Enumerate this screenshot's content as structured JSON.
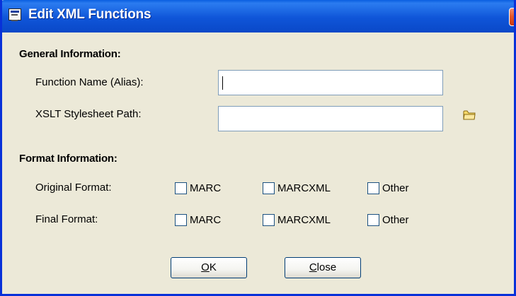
{
  "window": {
    "title": "Edit XML Functions",
    "close_symbol": "✕"
  },
  "general": {
    "heading": "General Information:",
    "function_name_label": "Function Name (Alias):",
    "function_name_value": "",
    "xslt_path_label": "XSLT Stylesheet Path:",
    "xslt_path_value": ""
  },
  "format": {
    "heading": "Format Information:",
    "original_label": "Original Format:",
    "final_label": "Final Format:",
    "options": [
      "MARC",
      "MARCXML",
      "Other"
    ],
    "original_checked": [
      false,
      false,
      false
    ],
    "final_checked": [
      false,
      false,
      false
    ]
  },
  "buttons": {
    "ok_mnemonic": "O",
    "ok_rest": "K",
    "close_mnemonic": "C",
    "close_rest": "lose"
  },
  "icons": {
    "title_icon": "window-app-icon",
    "browse_icon": "folder-icon"
  },
  "colors": {
    "titlebar": "#0f55d8",
    "dialog_bg": "#ece9d8",
    "close_button": "#e45a2c"
  }
}
